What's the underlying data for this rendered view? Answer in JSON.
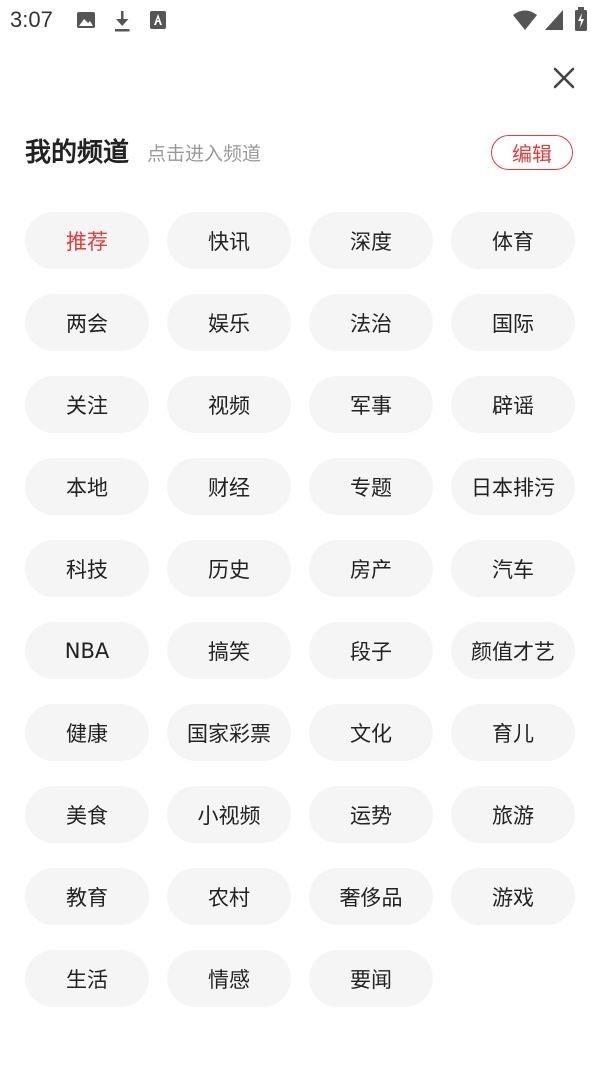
{
  "status_bar": {
    "time": "3:07",
    "icons_left": [
      "image-icon",
      "download-icon",
      "text-a-icon"
    ],
    "icons_right": [
      "wifi-icon",
      "signal-icon",
      "battery-icon"
    ]
  },
  "header": {
    "title": "我的频道",
    "subtitle": "点击进入频道",
    "edit_label": "编辑"
  },
  "colors": {
    "accent": "#e53c3c",
    "chip_bg": "#f5f5f5",
    "subtle_text": "#999999"
  },
  "channels": [
    {
      "label": "推荐",
      "active": true
    },
    {
      "label": "快讯"
    },
    {
      "label": "深度"
    },
    {
      "label": "体育"
    },
    {
      "label": "两会"
    },
    {
      "label": "娱乐"
    },
    {
      "label": "法治"
    },
    {
      "label": "国际"
    },
    {
      "label": "关注"
    },
    {
      "label": "视频"
    },
    {
      "label": "军事"
    },
    {
      "label": "辟谣"
    },
    {
      "label": "本地"
    },
    {
      "label": "财经"
    },
    {
      "label": "专题"
    },
    {
      "label": "日本排污"
    },
    {
      "label": "科技"
    },
    {
      "label": "历史"
    },
    {
      "label": "房产"
    },
    {
      "label": "汽车"
    },
    {
      "label": "NBA"
    },
    {
      "label": "搞笑"
    },
    {
      "label": "段子"
    },
    {
      "label": "颜值才艺"
    },
    {
      "label": "健康"
    },
    {
      "label": "国家彩票"
    },
    {
      "label": "文化"
    },
    {
      "label": "育儿"
    },
    {
      "label": "美食"
    },
    {
      "label": "小视频"
    },
    {
      "label": "运势"
    },
    {
      "label": "旅游"
    },
    {
      "label": "教育"
    },
    {
      "label": "农村"
    },
    {
      "label": "奢侈品"
    },
    {
      "label": "游戏"
    },
    {
      "label": "生活"
    },
    {
      "label": "情感"
    },
    {
      "label": "要闻"
    }
  ]
}
